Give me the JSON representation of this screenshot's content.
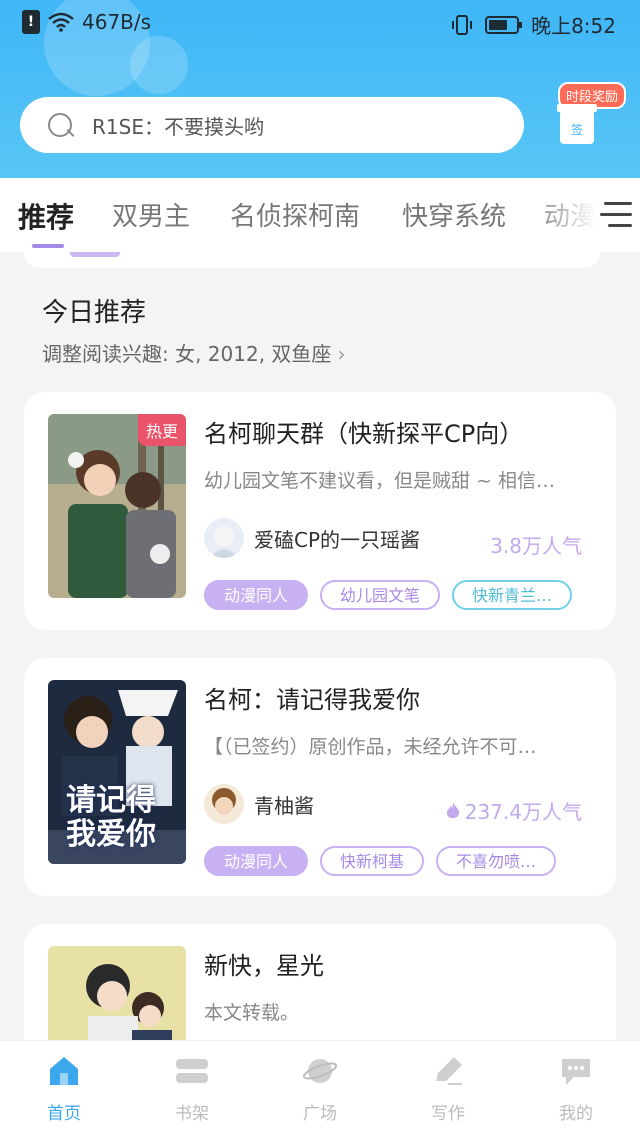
{
  "status": {
    "speed": "467B/s",
    "time": "晚上8:52",
    "battery_level": 0.7
  },
  "search": {
    "placeholder": "R1SE：不要摸头哟"
  },
  "reward": {
    "badge": "时段奖励",
    "gift_label": "签"
  },
  "tabs": [
    {
      "label": "推荐",
      "active": true
    },
    {
      "label": "双男主"
    },
    {
      "label": "名侦探柯南"
    },
    {
      "label": "快穿系统"
    },
    {
      "label": "动漫"
    }
  ],
  "recommend": {
    "title": "今日推荐",
    "subtitle": "调整阅读兴趣: 女, 2012, 双鱼座"
  },
  "books": [
    {
      "hot_badge": "热更",
      "title": "名柯聊天群（快新探平CP向）",
      "desc": "幼儿园文笔不建议看，但是贼甜 ~ 相信…",
      "author": "爱磕CP的一只瑶酱",
      "popularity": "3.8万人气",
      "tags": [
        "动漫同人",
        "幼儿园文笔",
        "快新青兰…"
      ]
    },
    {
      "title": "名柯：请记得我爱你",
      "desc": "【（已签约）原创作品，未经允许不可…",
      "author": "青柚酱",
      "popularity": "237.4万人气",
      "cover_text": "请记得我爱你",
      "tags": [
        "动漫同人",
        "快新柯基",
        "不喜勿喷…"
      ]
    },
    {
      "title": "新快，星光",
      "desc": "本文转载。"
    }
  ],
  "nav": [
    {
      "label": "首页",
      "icon": "home-icon",
      "active": true
    },
    {
      "label": "书架",
      "icon": "bookshelf-icon"
    },
    {
      "label": "广场",
      "icon": "planet-icon"
    },
    {
      "label": "写作",
      "icon": "pen-icon"
    },
    {
      "label": "我的",
      "icon": "chat-bubble-icon"
    }
  ],
  "colors": {
    "header": "#3fb6f7",
    "accent_purple": "#c7b1f2",
    "active_blue": "#3aa7ef",
    "hot_red": "#e9546b"
  }
}
